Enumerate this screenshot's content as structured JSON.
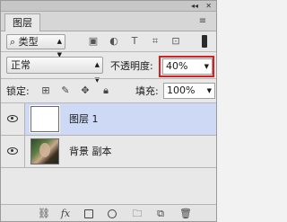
{
  "panel": {
    "title_controls": {
      "collapse": "◂◂",
      "close": "✕"
    },
    "tab_label": "图层",
    "menu_icon": "panel-menu-icon"
  },
  "filter": {
    "kind_label": "⌕ 类型",
    "icons": [
      "pixel-filter-icon",
      "adjustment-filter-icon",
      "type-filter-icon",
      "shape-filter-icon",
      "smart-object-filter-icon"
    ]
  },
  "blend": {
    "mode": "正常",
    "opacity_label": "不透明度:",
    "opacity_value": "40%",
    "highlight_color": "#d42020"
  },
  "lock": {
    "label": "锁定:",
    "icons": [
      "lock-transparent-icon",
      "lock-paint-icon",
      "lock-move-icon",
      "lock-all-icon"
    ],
    "fill_label": "填充:",
    "fill_value": "100%"
  },
  "layers": [
    {
      "name": "图层 1",
      "visible": true,
      "selected": true
    },
    {
      "name": "背景 副本",
      "visible": true,
      "selected": false
    }
  ],
  "bottom_toolbar": [
    "link-icon",
    "fx-icon",
    "mask-icon",
    "adjustment-icon",
    "folder-icon",
    "new-layer-icon",
    "trash-icon"
  ]
}
